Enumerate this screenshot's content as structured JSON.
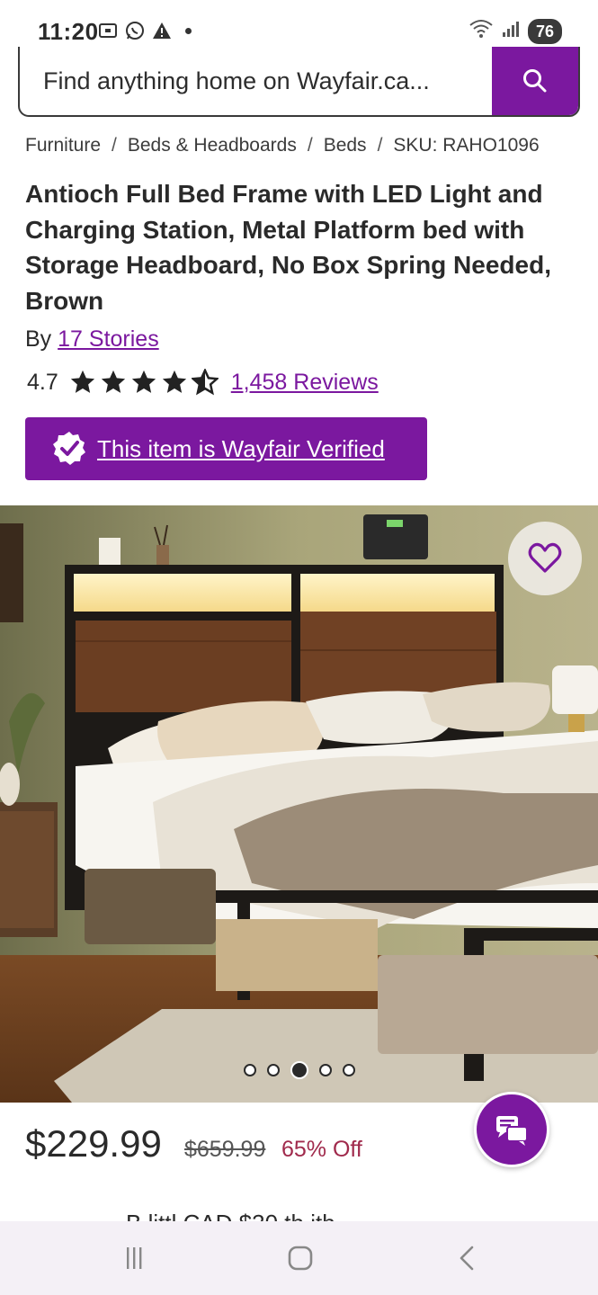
{
  "status_bar": {
    "time": "11:20",
    "battery": "76",
    "icons_left": [
      "screenshot-icon",
      "whatsapp-icon",
      "warning-icon",
      "dot-icon"
    ],
    "icons_right": [
      "wifi-icon",
      "signal-icon",
      "battery-icon"
    ]
  },
  "search": {
    "placeholder": "Find anything home on Wayfair.ca..."
  },
  "breadcrumb": {
    "items": [
      "Furniture",
      "Beds & Headboards",
      "Beds",
      "SKU: RAHO1096"
    ],
    "separator": "/"
  },
  "product": {
    "title": "Antioch Full Bed Frame with LED Light and Charging Station, Metal Platform bed with Storage Headboard, No Box Spring Needed, Brown",
    "by_label": "By",
    "brand": "17 Stories",
    "rating": "4.7",
    "rating_value": 4.7,
    "rating_max": 5,
    "reviews": "1,458 Reviews",
    "verified_label": "This item is Wayfair Verified",
    "image_count": 5,
    "image_active_index": 2,
    "price": "$229.99",
    "price_old": "$659.99",
    "discount": "65% Off",
    "partial_text": "B     littl    CAD $30          th    ith"
  },
  "colors": {
    "brand_purple": "#7b189f",
    "discount_red": "#a02a4c"
  },
  "nav": {
    "items": [
      "recents-icon",
      "home-icon",
      "back-icon"
    ]
  }
}
